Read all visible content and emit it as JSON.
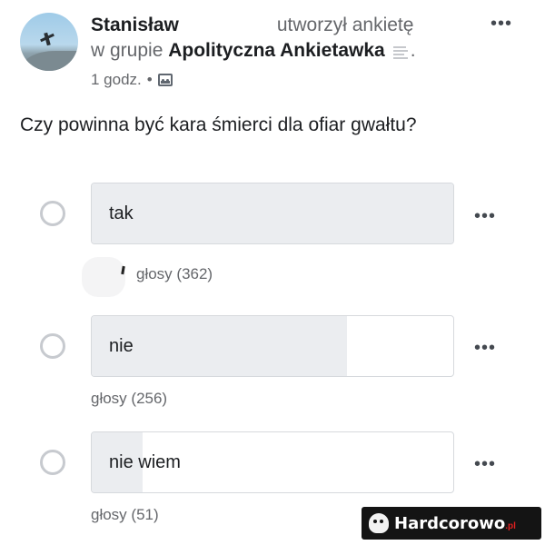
{
  "post": {
    "author": "Stanisław",
    "action": "utworzył ankietę",
    "group_prefix": "w grupie",
    "group_name": "Apolityczna Ankietawka",
    "group_suffix": ".",
    "time": "1 godz.",
    "separator": "•",
    "more_label": "•••"
  },
  "poll": {
    "question": "Czy powinna być kara śmierci dla ofiar gwałtu?",
    "options": [
      {
        "label": "tak",
        "votes_text": "głosy (362)",
        "votes": 362,
        "fill_fraction": 1.0
      },
      {
        "label": "nie",
        "votes_text": "głosy (256)",
        "votes": 256,
        "fill_fraction": 0.707
      },
      {
        "label": "nie wiem",
        "votes_text": "głosy (51)",
        "votes": 51,
        "fill_fraction": 0.141
      }
    ]
  },
  "watermark": {
    "text": "Hardcorowo",
    "tld": ".pl"
  },
  "icons": {
    "avatar": "user-avatar",
    "group": "group-document-icon",
    "privacy": "group-privacy-icon",
    "more": "more-horizontal-icon",
    "radio": "radio-button-icon",
    "watermark": "skull-icon"
  }
}
